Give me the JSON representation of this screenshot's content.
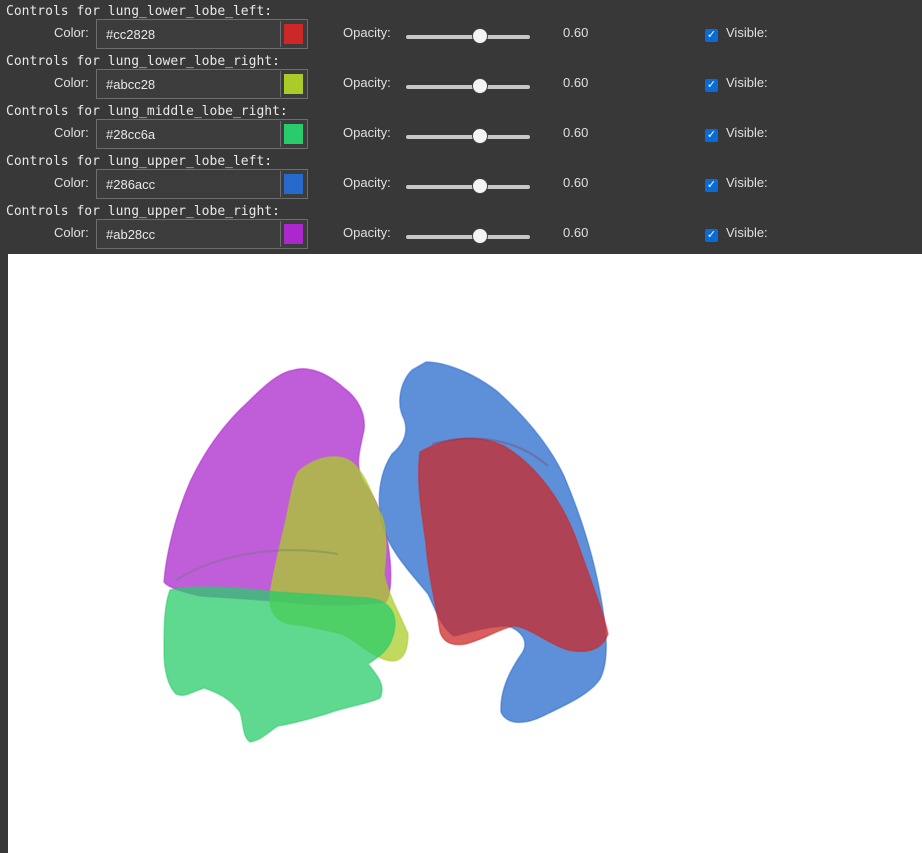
{
  "controls": [
    {
      "name": "lung_lower_lobe_left",
      "header": "Controls for lung_lower_lobe_left:",
      "color": "#cc2828",
      "opacity": 0.6,
      "opacity_text": "0.60",
      "visible": true
    },
    {
      "name": "lung_lower_lobe_right",
      "header": "Controls for lung_lower_lobe_right:",
      "color": "#abcc28",
      "opacity": 0.6,
      "opacity_text": "0.60",
      "visible": true
    },
    {
      "name": "lung_middle_lobe_right",
      "header": "Controls for lung_middle_lobe_right:",
      "color": "#28cc6a",
      "opacity": 0.6,
      "opacity_text": "0.60",
      "visible": true
    },
    {
      "name": "lung_upper_lobe_left",
      "header": "Controls for lung_upper_lobe_left:",
      "color": "#286acc",
      "opacity": 0.6,
      "opacity_text": "0.60",
      "visible": true
    },
    {
      "name": "lung_upper_lobe_right",
      "header": "Controls for lung_upper_lobe_right:",
      "color": "#ab28cc",
      "opacity": 0.6,
      "opacity_text": "0.60",
      "visible": true
    }
  ],
  "labels": {
    "color": "Color:",
    "opacity": "Opacity:",
    "visible": "Visible:"
  },
  "colors": {
    "panel_bg": "#383838",
    "checkbox_accent": "#0b6bd6",
    "viewer_bg": "#ffffff"
  }
}
